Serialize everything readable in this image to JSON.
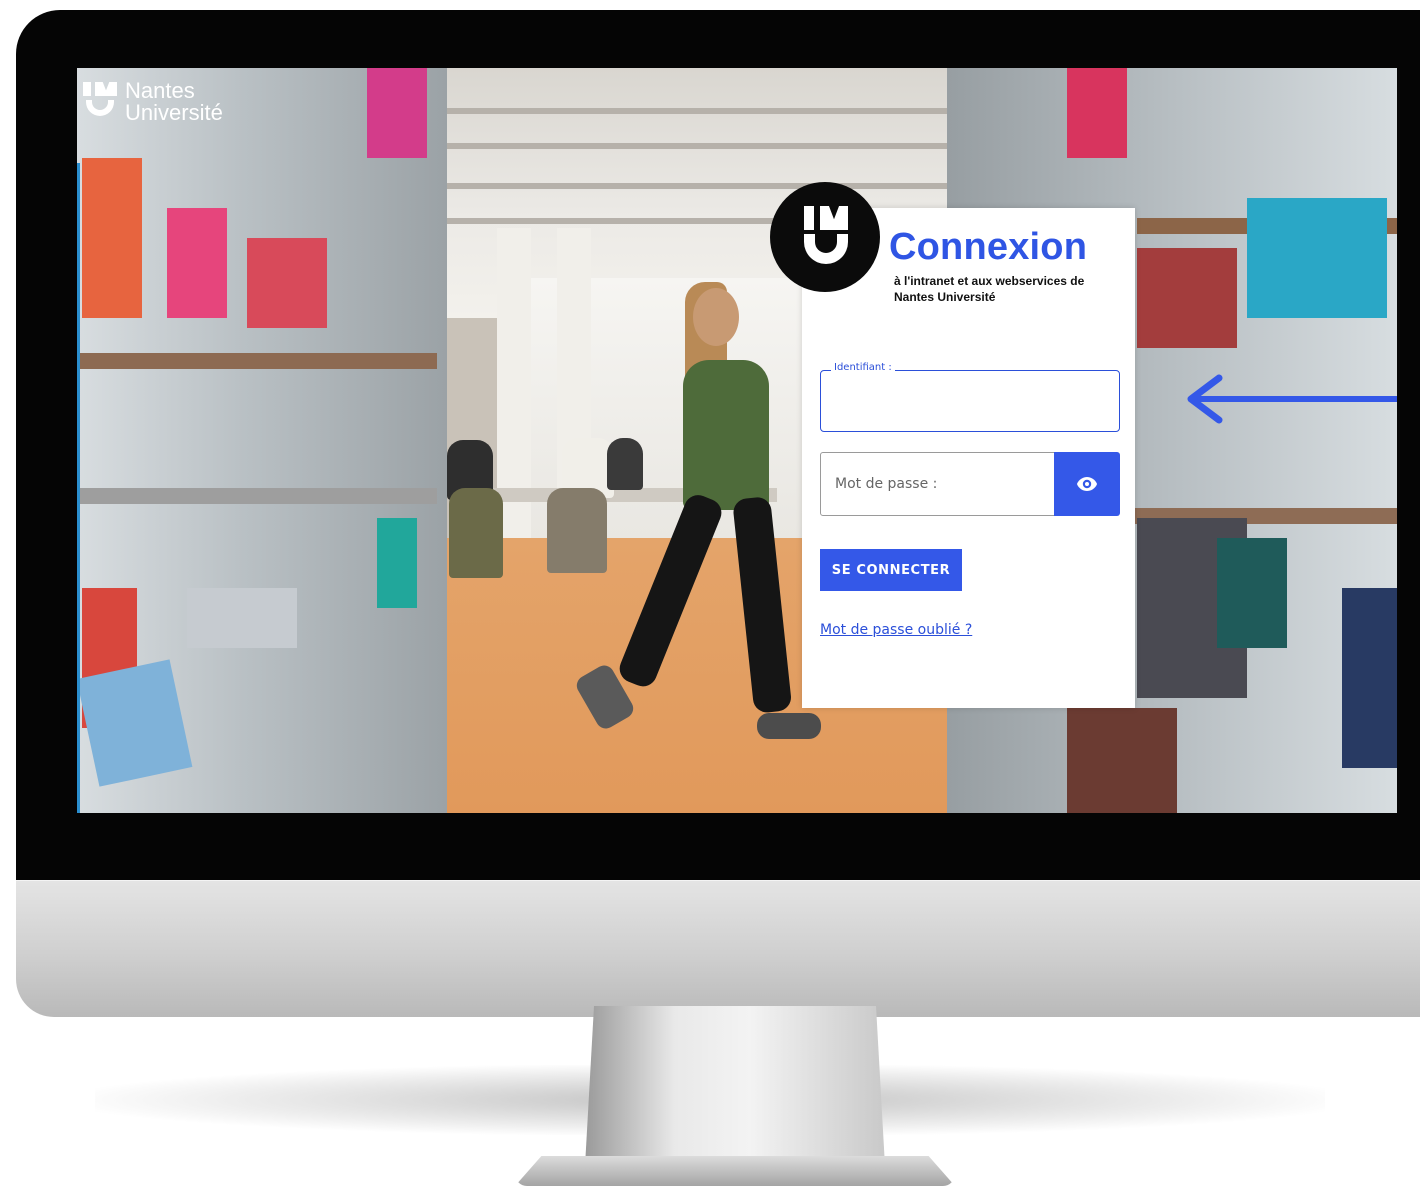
{
  "site_logo": {
    "line1": "Nantes",
    "line2": "Université"
  },
  "login": {
    "title": "Connexion",
    "subtitle": "à l'intranet et aux webservices de Nantes Université",
    "identifiant_label": "Identifiant :",
    "identifiant_value": "",
    "password_placeholder": "Mot de passe :",
    "password_value": "",
    "submit_label": "SE CONNECTER",
    "forgot_link": "Mot de passe oublié ?"
  },
  "icons": {
    "show_password": "eye-icon",
    "annotation": "arrow-left-icon"
  },
  "colors": {
    "accent": "#3458e8",
    "title": "#2f55e4",
    "bezel": "#050505"
  }
}
